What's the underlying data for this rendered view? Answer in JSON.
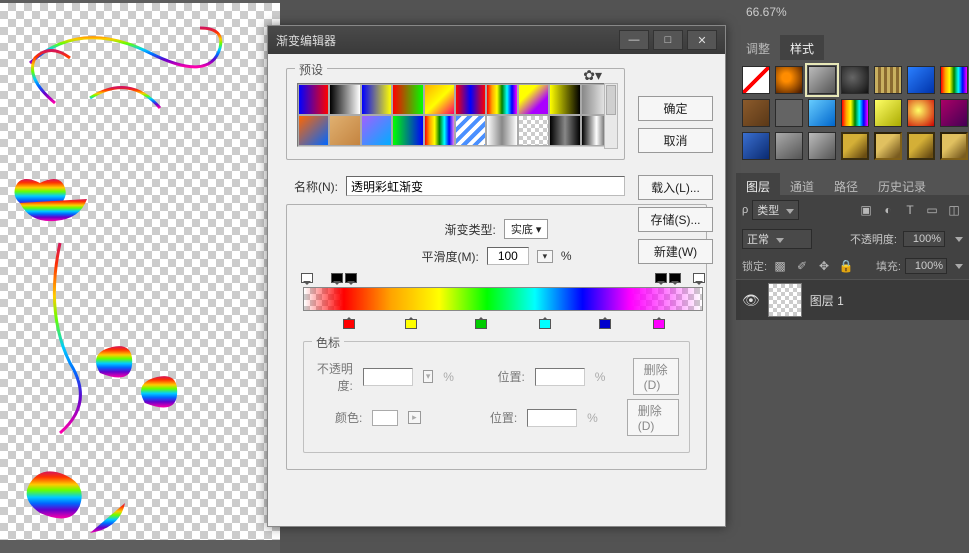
{
  "zoom": "66.67%",
  "dialog": {
    "title": "渐变编辑器",
    "presets_label": "预设",
    "name_label": "名称(N):",
    "name_value": "透明彩虹渐变",
    "grad_type_label": "渐变类型:",
    "grad_type_value": "实底",
    "smooth_label": "平滑度(M):",
    "smooth_value": "100",
    "percent": "%",
    "stops_label": "色标",
    "opacity_label": "不透明度:",
    "location_label": "位置:",
    "color_label": "颜色:",
    "delete_btn": "删除(D)",
    "buttons": {
      "ok": "确定",
      "cancel": "取消",
      "load": "载入(L)...",
      "save": "存储(S)...",
      "new": "新建(W)"
    }
  },
  "panels": {
    "adjust_tab": "调整",
    "styles_tab": "样式",
    "layers_tab": "图层",
    "channels_tab": "通道",
    "paths_tab": "路径",
    "history_tab": "历史记录",
    "type_label": "类型",
    "blend_mode": "正常",
    "opacity_label": "不透明度:",
    "opacity_value": "100%",
    "lock_label": "锁定:",
    "fill_label": "填充:",
    "fill_value": "100%",
    "layer1": "图层 1"
  }
}
